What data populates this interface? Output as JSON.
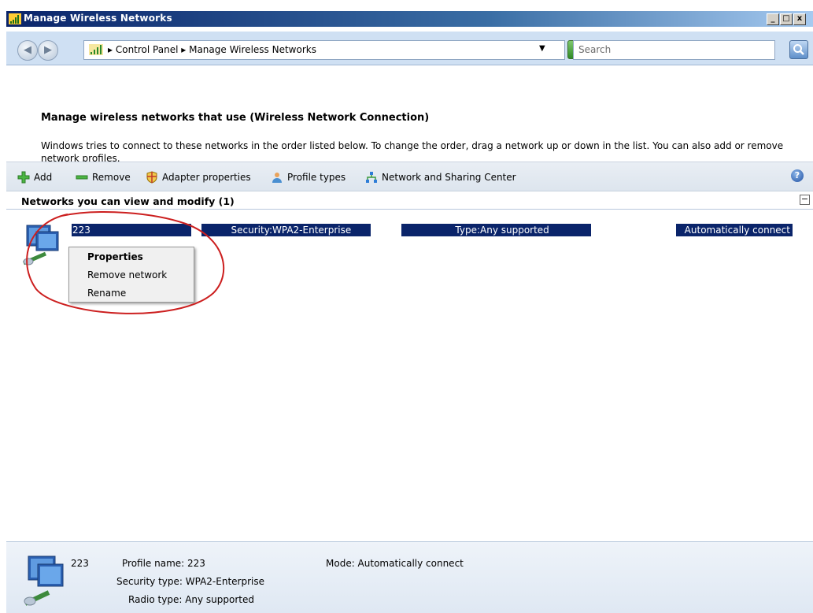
{
  "window": {
    "title": "Manage Wireless Networks"
  },
  "address": {
    "crumbs": [
      "Control Panel",
      "Manage Wireless Networks"
    ],
    "search_placeholder": "Search"
  },
  "page": {
    "heading": "Manage wireless networks that use (Wireless Network Connection)",
    "description": "Windows tries to connect to these networks in the order listed below. To change the order, drag a network up or down in the list. You can also add or remove network profiles."
  },
  "toolbar": {
    "add": "Add",
    "remove": "Remove",
    "adapter": "Adapter properties",
    "profile_types": "Profile types",
    "sharing": "Network and Sharing Center"
  },
  "group": {
    "label": "Networks you can view and modify (1)"
  },
  "network": {
    "name": "223",
    "security_label": "Security:",
    "security_value": "WPA2-Enterprise",
    "type_label": "Type:",
    "type_value": "Any supported",
    "connect_mode": "Automatically connect"
  },
  "context_menu": {
    "items": [
      "Properties",
      "Remove network",
      "Rename"
    ]
  },
  "details": {
    "name": "223",
    "profile_name": "Profile name: 223",
    "mode": "Mode: Automatically connect",
    "security_type": "Security type: WPA2-Enterprise",
    "radio_type": "Radio type: Any supported"
  },
  "colors": {
    "selection": "#0a246a",
    "annotation": "#cc1f1f",
    "titlebar": "#0a246a"
  },
  "icons": [
    "signal-icon",
    "back-icon",
    "forward-icon",
    "go-icon",
    "search-icon",
    "add-icon",
    "remove-icon",
    "shield-icon",
    "users-icon",
    "network-icon",
    "help-icon",
    "computer-network-icon"
  ]
}
